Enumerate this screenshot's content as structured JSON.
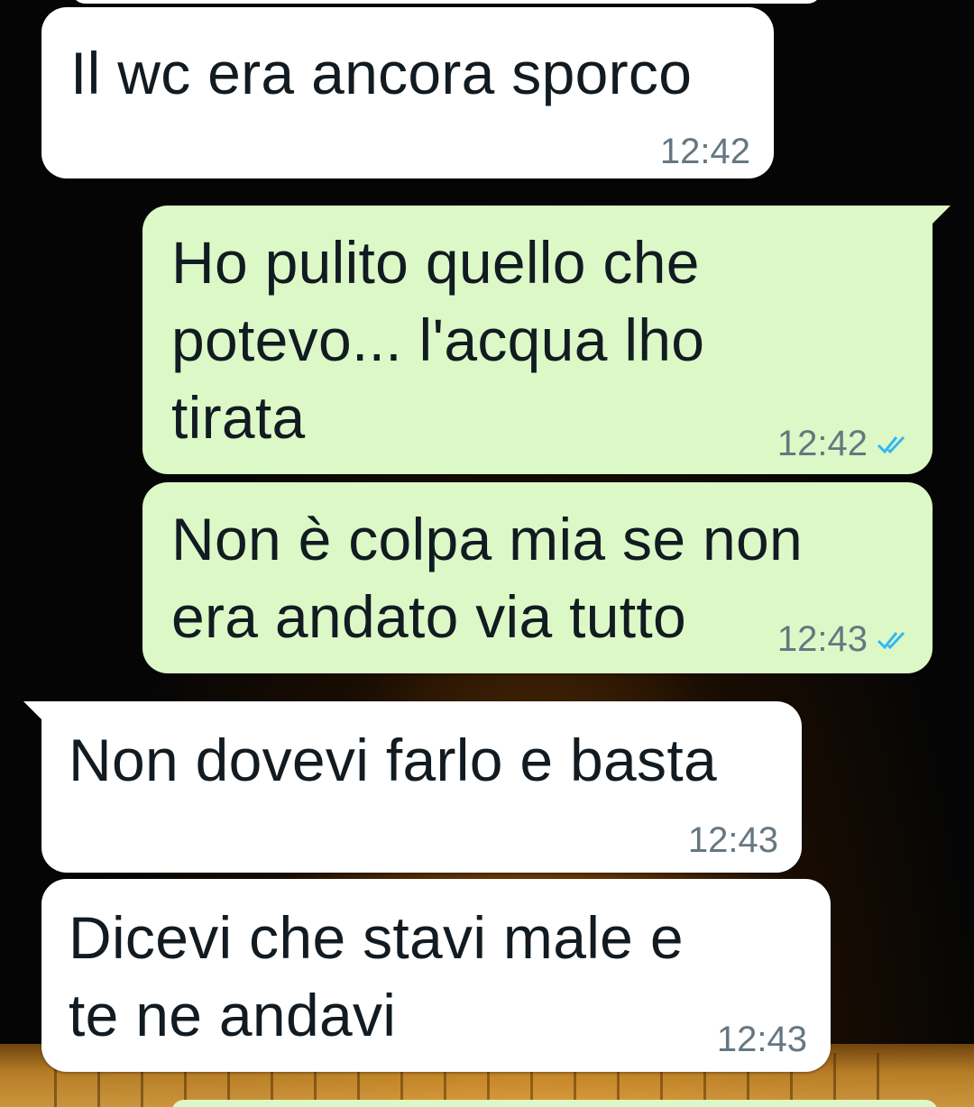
{
  "chat": {
    "messages": [
      {
        "direction": "in",
        "text": "Il wc era ancora sporco",
        "time": "12:42"
      },
      {
        "direction": "out",
        "text": "Ho pulito quello che\npotevo...  l'acqua lho\ntirata",
        "time": "12:42",
        "status": "read",
        "status_icon": "double-check-icon"
      },
      {
        "direction": "out",
        "text": "Non è colpa mia se non\nera andato via tutto",
        "time": "12:43",
        "status": "read",
        "status_icon": "double-check-icon"
      },
      {
        "direction": "in",
        "text": "Non dovevi farlo e basta",
        "time": "12:43"
      },
      {
        "direction": "in",
        "text": "Dicevi che stavi male e\nte ne andavi",
        "time": "12:43"
      }
    ]
  },
  "colors": {
    "incoming_bubble": "#ffffff",
    "outgoing_bubble": "#dcf8c6",
    "text": "#111b21",
    "time": "#667781",
    "read_ticks": "#34b7f1"
  }
}
